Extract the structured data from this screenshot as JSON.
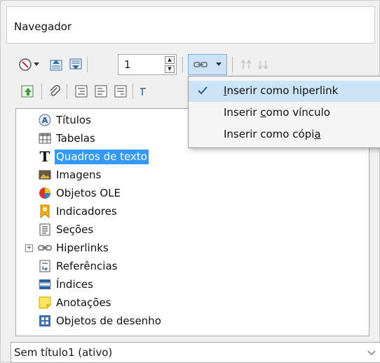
{
  "window": {
    "title": "Navegador"
  },
  "toolbar": {
    "spin_value": "1"
  },
  "dropdown_menu": {
    "items": [
      {
        "pre": "",
        "ul": "I",
        "post": "nserir como hiperlink",
        "checked": true
      },
      {
        "pre": "Inserir ",
        "ul": "c",
        "post": "omo vínculo",
        "checked": false
      },
      {
        "pre": "Inserir como cópi",
        "ul": "a",
        "post": "",
        "checked": false
      }
    ]
  },
  "tree": {
    "items": [
      {
        "label": "Títulos",
        "icon": "headings-icon"
      },
      {
        "label": "Tabelas",
        "icon": "table-icon"
      },
      {
        "label": "Quadros de texto",
        "icon": "text-frame-icon",
        "selected": true
      },
      {
        "label": "Imagens",
        "icon": "image-icon"
      },
      {
        "label": "Objetos OLE",
        "icon": "ole-object-icon"
      },
      {
        "label": "Indicadores",
        "icon": "bookmark-icon"
      },
      {
        "label": "Seções",
        "icon": "section-icon"
      },
      {
        "label": "Hiperlinks",
        "icon": "hyperlink-icon",
        "expandable": true
      },
      {
        "label": "Referências",
        "icon": "reference-icon"
      },
      {
        "label": "Índices",
        "icon": "index-icon"
      },
      {
        "label": "Anotações",
        "icon": "comment-icon"
      },
      {
        "label": "Objetos de desenho",
        "icon": "drawing-object-icon"
      }
    ]
  },
  "document_selector": {
    "value": "Sem título1 (ativo)"
  },
  "colors": {
    "selection": "#3399ff",
    "menu_highlight": "#cce4f7"
  }
}
